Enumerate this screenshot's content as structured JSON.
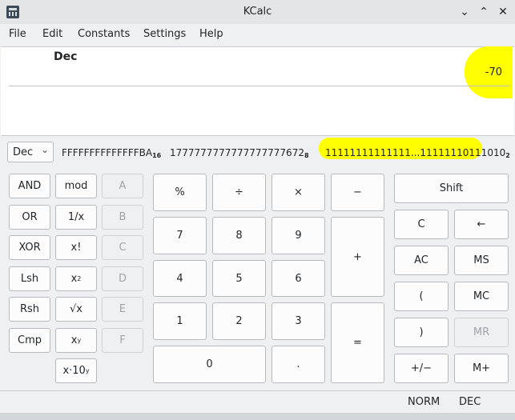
{
  "window": {
    "title": "KCalc",
    "minimize_glyph": "⌄",
    "maximize_glyph": "⌃",
    "close_glyph": "✕"
  },
  "menu": [
    "File",
    "Edit",
    "Constants",
    "Settings",
    "Help"
  ],
  "display": {
    "mode": "Dec",
    "value": "-70"
  },
  "base_select": {
    "value": "Dec",
    "chevron": "⌄"
  },
  "conversions": {
    "hex": "FFFFFFFFFFFFFFBA",
    "hex_base": "16",
    "oct": "1777777777777777777672",
    "oct_base": "8",
    "bin": "11111111111111...11111110111010",
    "bin_base": "2"
  },
  "logic_buttons": {
    "and": "AND",
    "or": "OR",
    "xor": "XOR",
    "lsh": "Lsh",
    "rsh": "Rsh",
    "cmp": "Cmp"
  },
  "func_buttons": {
    "mod": "mod",
    "reciprocal": "1/x",
    "factorial": "x!",
    "square_base": "x",
    "square_exp": "2",
    "sqrt": "√x",
    "power_base": "x",
    "power_exp": "y",
    "exp10": "x·10",
    "exp10_exp": "y"
  },
  "hex_buttons": {
    "a": "A",
    "b": "B",
    "c": "C",
    "d": "D",
    "e": "E",
    "f": "F"
  },
  "numpad": {
    "percent": "%",
    "divide": "÷",
    "multiply": "×",
    "minus": "−",
    "n7": "7",
    "n8": "8",
    "n9": "9",
    "plus": "+",
    "n4": "4",
    "n5": "5",
    "n6": "6",
    "n1": "1",
    "n2": "2",
    "n3": "3",
    "equals": "=",
    "n0": "0",
    "decimal": "."
  },
  "right_buttons": {
    "shift": "Shift",
    "clear": "C",
    "backspace": "←",
    "all_clear": "AC",
    "mem_store": "MS",
    "open_paren": "(",
    "mem_clear": "MC",
    "close_paren": ")",
    "mem_recall": "MR",
    "plus_minus": "+/−",
    "mem_plus": "M+"
  },
  "status": {
    "angle": "NORM",
    "base": "DEC"
  },
  "colors": {
    "highlight": "#ffff00",
    "window_bg": "#eff0f1",
    "display_bg": "#ffffff"
  }
}
